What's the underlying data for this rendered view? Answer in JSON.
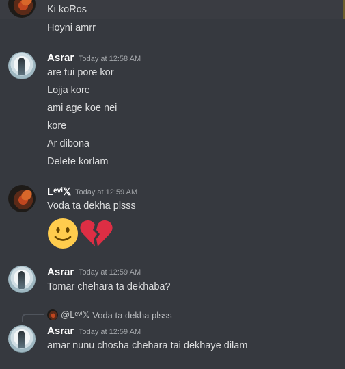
{
  "top_group": {
    "messages": [
      "Ki koRos",
      "Hoyni amrr"
    ]
  },
  "groups": [
    {
      "author": "Asrar",
      "timestamp": "Today at 12:58 AM",
      "messages": [
        "are tui pore kor",
        "Lojja kore",
        "ami age koe nei",
        "kore",
        "Ar dibona",
        "Delete korlam"
      ]
    },
    {
      "author": "Lᵉᵛⁱ𝕏",
      "timestamp": "Today at 12:59 AM",
      "messages": [
        "Voda ta dekha plsss"
      ],
      "emojis": [
        "slightly-smiling-face",
        "broken-heart"
      ]
    },
    {
      "author": "Asrar",
      "timestamp": "Today at 12:59 AM",
      "messages": [
        "Tomar chehara ta dekhaba?"
      ]
    },
    {
      "author": "Asrar",
      "timestamp": "Today at 12:59 AM",
      "reply": {
        "author": "@Lᵉᵛⁱ𝕏",
        "text": "Voda ta dekha plsss"
      },
      "messages": [
        "amar nunu chosha chehara tai dekhaye dilam"
      ]
    }
  ],
  "colors": {
    "background": "#36393f",
    "text": "#dcddde",
    "username": "#ffffff",
    "timestamp": "#a3a6aa",
    "highlight_bar": "#6d5f2e"
  }
}
